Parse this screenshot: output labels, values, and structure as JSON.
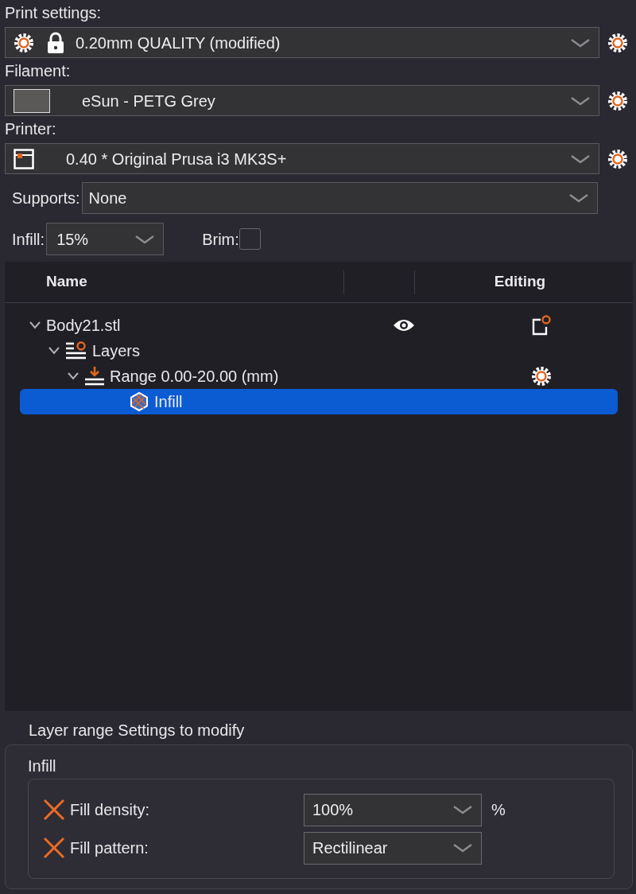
{
  "print_settings": {
    "label": "Print settings:",
    "value": "0.20mm QUALITY (modified)"
  },
  "filament": {
    "label": "Filament:",
    "value": "eSun - PETG Grey",
    "color": "#5b5957"
  },
  "printer": {
    "label": "Printer:",
    "value": "0.40 * Original Prusa i3 MK3S+"
  },
  "supports": {
    "label": "Supports:",
    "value": "None"
  },
  "infill": {
    "label": "Infill:",
    "value": "15%"
  },
  "brim": {
    "label": "Brim:",
    "checked": false
  },
  "tree": {
    "columns": [
      "Name",
      "Editing"
    ],
    "items": [
      {
        "kind": "object",
        "label": "Body21.stl",
        "expanded": true,
        "selected": false,
        "children": [
          {
            "kind": "layers",
            "label": "Layers",
            "expanded": true,
            "selected": false,
            "children": [
              {
                "kind": "range",
                "label": "Range 0.00-20.00 (mm)",
                "expanded": true,
                "selected": false,
                "children": [
                  {
                    "kind": "infill",
                    "label": "Infill",
                    "selected": true
                  }
                ]
              }
            ]
          }
        ]
      }
    ]
  },
  "settings": {
    "title": "Layer range Settings to modify",
    "group": "Infill",
    "rows": [
      {
        "label": "Fill density:",
        "value": "100%",
        "unit": "%"
      },
      {
        "label": "Fill pattern:",
        "value": "Rectilinear"
      }
    ]
  }
}
